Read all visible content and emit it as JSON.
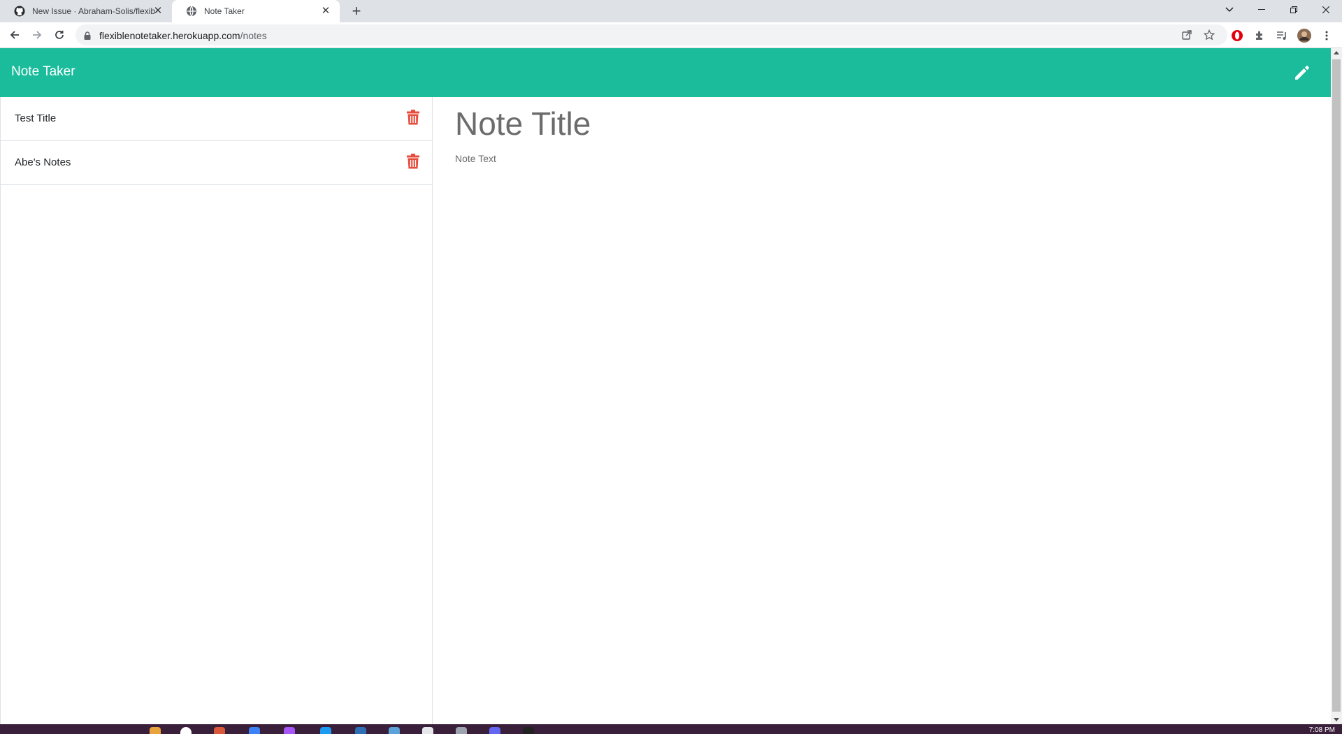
{
  "browser": {
    "tabs": [
      {
        "title": "New Issue · Abraham-Solis/flexib",
        "active": false,
        "icon": "github-icon"
      },
      {
        "title": "Note Taker",
        "active": true,
        "icon": "globe-icon"
      }
    ],
    "url_host": "flexiblenotetaker.herokuapp.com",
    "url_path": "/notes"
  },
  "app": {
    "brand": "Note Taker",
    "new_note_icon": "pencil-icon",
    "accent_color": "#1abc9c",
    "delete_color": "#e74c3c"
  },
  "notes": [
    {
      "title": "Test Title"
    },
    {
      "title": "Abe's Notes"
    }
  ],
  "editor": {
    "title_placeholder": "Note Title",
    "text_placeholder": "Note Text"
  },
  "taskbar": {
    "clock": "7:08 PM"
  }
}
